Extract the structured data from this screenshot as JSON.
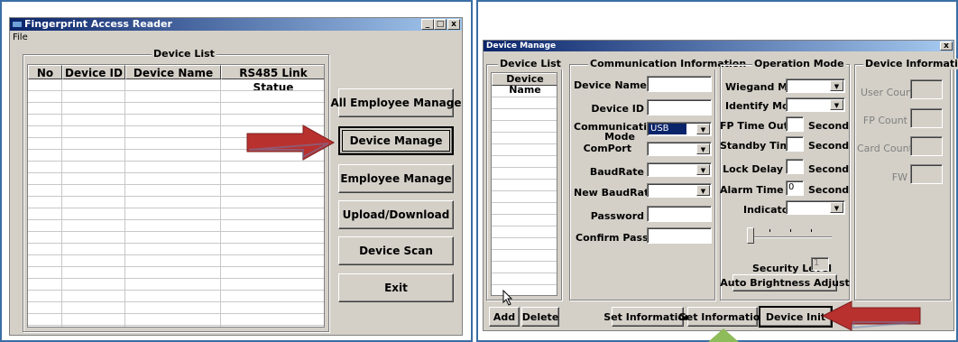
{
  "left_window": {
    "title": "Fingerprint Access Reader",
    "menu_file": "File",
    "window_buttons": {
      "minimize": "_",
      "maximize": "□",
      "close": "x"
    },
    "device_list": {
      "legend": "Device List",
      "columns": [
        "No",
        "Device ID",
        "Device Name",
        "RS485 Link Statue"
      ]
    },
    "buttons": {
      "all_employee": "All Employee Manage",
      "device_manage": "Device Manage",
      "employee_manage": "Employee Manage",
      "upload_download": "Upload/Download",
      "device_scan": "Device Scan",
      "exit": "Exit"
    }
  },
  "right_window": {
    "title": "Device Manage",
    "close": "x",
    "device_list": {
      "legend": "Device List",
      "column": "Device Name"
    },
    "communication": {
      "legend": "Communication Information",
      "device_name_label": "Device Name",
      "device_id_label": "Device ID",
      "comm_mode_label_1": "Communication",
      "comm_mode_label_2": "Mode",
      "comm_mode_value": "USB",
      "comport_label": "ComPort",
      "baudrate_label": "BaudRate",
      "new_baudrate_label": "New BaudRate",
      "password_label": "Password",
      "confirm_password_label": "Confirm Password"
    },
    "operation": {
      "legend": "Operation Mode",
      "wiegand_label": "Wiegand Mode",
      "identify_label": "Identify Mode",
      "fp_timeout_label": "FP Time Out",
      "standby_label": "Standby Time",
      "lock_delay_label": "Lock Delay",
      "alarm_time_label": "Alarm Time",
      "alarm_time_value": "0",
      "second": "Second",
      "indicator_label": "Indicator",
      "security_level_label": "Security Level",
      "security_level_value": "1",
      "auto_brightness": "Auto Brightness Adjust"
    },
    "device_info": {
      "legend": "Device Information",
      "user_count": "User Count",
      "fp_count": "FP Count",
      "card_count": "Card Count",
      "fw": "FW"
    },
    "buttons": {
      "add": "Add",
      "delete": "Delete",
      "set_information": "Set Information",
      "get_information": "Get Information",
      "device_init": "Device Init"
    }
  },
  "colors": {
    "arrow_red": "#b8312f",
    "arrow_green": "#8fbc5a",
    "frame_blue": "#3a6ea5",
    "window_gray": "#d4d0c8"
  }
}
